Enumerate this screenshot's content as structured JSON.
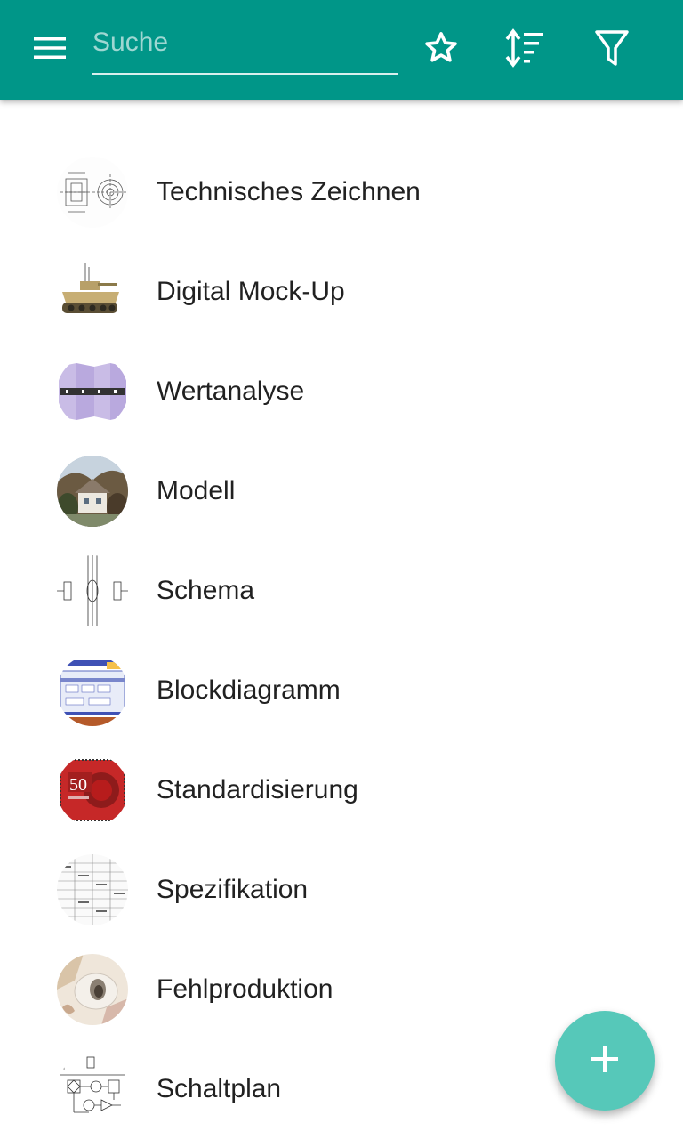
{
  "search": {
    "placeholder": "Suche",
    "value": ""
  },
  "toolbar": {
    "menu_icon": "menu-icon",
    "favorite_icon": "star-outline-icon",
    "sort_icon": "sort-icon",
    "filter_icon": "filter-icon"
  },
  "colors": {
    "appbar": "#009688",
    "fab": "#56c8b9",
    "text": "#212121"
  },
  "items": [
    {
      "label": "Technisches Zeichnen",
      "icon": "technical-drawing-thumbnail"
    },
    {
      "label": "Digital Mock-Up",
      "icon": "tank-model-thumbnail"
    },
    {
      "label": "Wertanalyse",
      "icon": "value-analysis-thumbnail"
    },
    {
      "label": "Modell",
      "icon": "house-model-thumbnail"
    },
    {
      "label": "Schema",
      "icon": "schema-thumbnail"
    },
    {
      "label": "Blockdiagramm",
      "icon": "block-diagram-thumbnail"
    },
    {
      "label": "Standardisierung",
      "icon": "standardization-stamp-thumbnail"
    },
    {
      "label": "Spezifikation",
      "icon": "specification-thumbnail"
    },
    {
      "label": "Fehlproduktion",
      "icon": "misprint-thumbnail"
    },
    {
      "label": "Schaltplan",
      "icon": "circuit-diagram-thumbnail"
    }
  ],
  "fab": {
    "icon": "plus-icon"
  }
}
